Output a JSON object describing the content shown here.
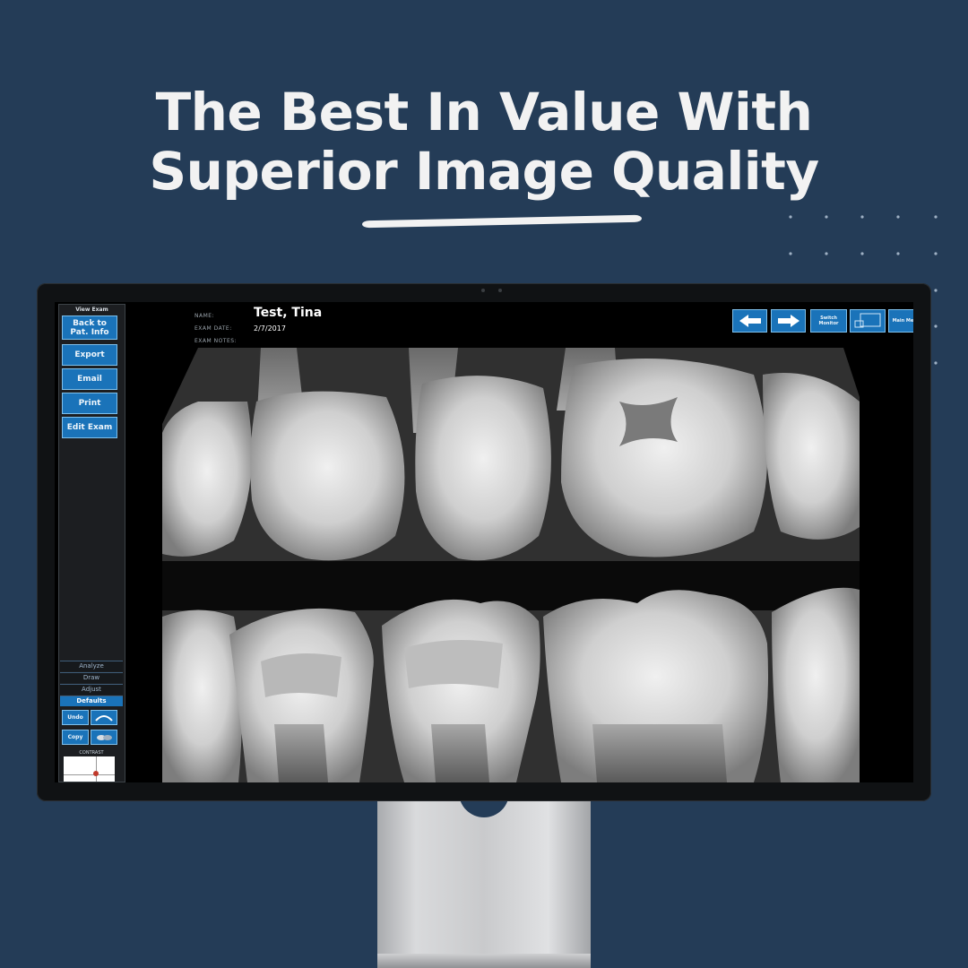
{
  "headline": {
    "line1": "The Best In Value With",
    "line2": "Superior Image Quality"
  },
  "colors": {
    "background": "#243c57",
    "headline": "#f2f2f2",
    "button_blue": "#1a73b9",
    "button_border": "#7ec0ec"
  },
  "app": {
    "side_panel": {
      "caption": "View Exam",
      "buttons": [
        "Back to Pat. Info",
        "Export",
        "Email",
        "Print",
        "Edit Exam"
      ],
      "tabs": [
        "Analyze",
        "Draw",
        "Adjust",
        "Defaults"
      ],
      "active_tab": "Defaults",
      "tool_buttons": [
        "Undo",
        "Copy"
      ],
      "tool_icons": [
        "curve-tool-icon",
        "eraser-tool-icon"
      ],
      "contrast_label": "CONTRAST"
    },
    "header": {
      "name_label": "NAME:",
      "exam_date_label": "EXAM DATE:",
      "exam_notes_label": "EXAM NOTES:",
      "patient_name": "Test, Tina",
      "exam_date": "2/7/2017"
    },
    "toolbar": {
      "prev_icon": "arrow-left-icon",
      "next_icon": "arrow-right-icon",
      "switch_monitor": "Switch Monitor",
      "dual_monitor_icon": "monitor-icon",
      "main_menu": "Main Menu"
    },
    "image": "dental-bitewing-xray"
  }
}
